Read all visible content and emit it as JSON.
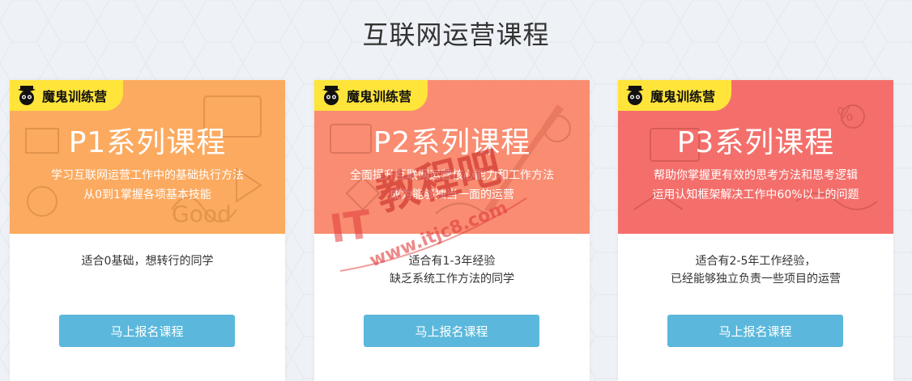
{
  "page": {
    "title": "互联网运营课程"
  },
  "colors": {
    "card1_banner": "#fcaa5f",
    "card2_banner": "#f98c71",
    "card3_banner": "#f46f6b",
    "badge": "#ffe43a",
    "enroll_button": "#5bb8dc",
    "background": "#eef2f6"
  },
  "cards": [
    {
      "badge": "魔鬼训练营",
      "series": "P1系列课程",
      "desc_line1": "学习互联网运营工作中的基础执行方法",
      "desc_line2": "从0到1掌握各项基本技能",
      "audience_line1": "适合0基础，想转行的同学",
      "audience_line2": "",
      "button": "马上报名课程"
    },
    {
      "badge": "魔鬼训练营",
      "series": "P2系列课程",
      "desc_line1": "全面提升互联网运营核心能力和工作方法",
      "desc_line2": "成为能够独当一面的运营",
      "audience_line1": "适合有1-3年经验",
      "audience_line2": "缺乏系统工作方法的同学",
      "button": "马上报名课程"
    },
    {
      "badge": "魔鬼训练营",
      "series": "P3系列课程",
      "desc_line1": "帮助你掌握更有效的思考方法和思考逻辑",
      "desc_line2": "运用认知框架解决工作中60%以上的问题",
      "audience_line1": "适合有2-5年工作经验，",
      "audience_line2": "已经能够独立负责一些项目的运营",
      "button": "马上报名课程"
    }
  ],
  "watermark": {
    "text1": "IT",
    "text2": "教程吧",
    "url": "www.itjc8.com"
  }
}
